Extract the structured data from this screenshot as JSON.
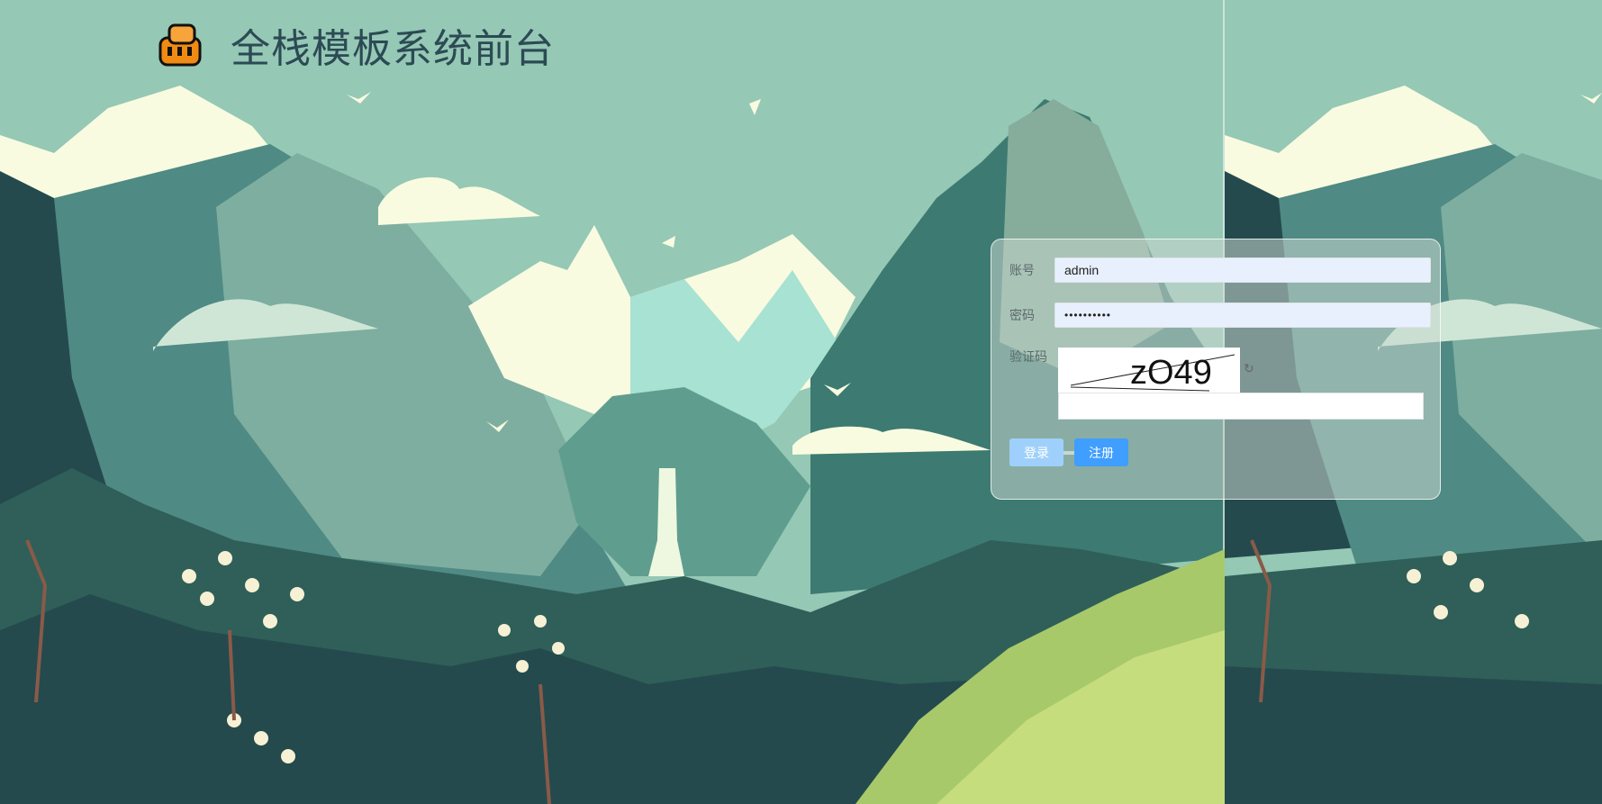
{
  "app": {
    "title": "全栈模板系统前台"
  },
  "login": {
    "account_label": "账号",
    "account_value": "admin",
    "password_label": "密码",
    "password_value": "••••••••••",
    "captcha_label": "验证码",
    "captcha_text": "zO49",
    "captcha_input_value": "",
    "login_button": "登录",
    "register_button": "注册"
  },
  "icons": {
    "logo": "logo-icon",
    "refresh": "refresh-icon"
  },
  "colors": {
    "primary_button": "#409eff",
    "disabled_button": "#9fd0fb",
    "autofill_background": "#e8f0fe",
    "sky": "#95c8b5"
  }
}
